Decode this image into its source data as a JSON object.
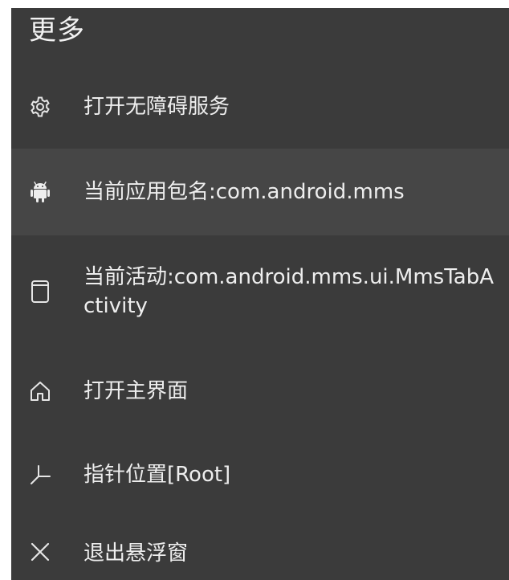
{
  "menu": {
    "title": "更多",
    "items": [
      {
        "label": "打开无障碍服务",
        "icon": "gear-icon"
      },
      {
        "label": "当前应用包名:com.android.mms",
        "icon": "android-icon"
      },
      {
        "label": "当前活动:com.android.mms.ui.MmsTabActivity",
        "icon": "window-icon"
      },
      {
        "label": "打开主界面",
        "icon": "home-icon"
      },
      {
        "label": "指针位置[Root]",
        "icon": "pointer-axis-icon"
      },
      {
        "label": "退出悬浮窗",
        "icon": "close-icon"
      }
    ]
  },
  "colors": {
    "panel_background": "#3b3b3b",
    "highlight_background": "#464646",
    "text": "#eeeeee"
  }
}
